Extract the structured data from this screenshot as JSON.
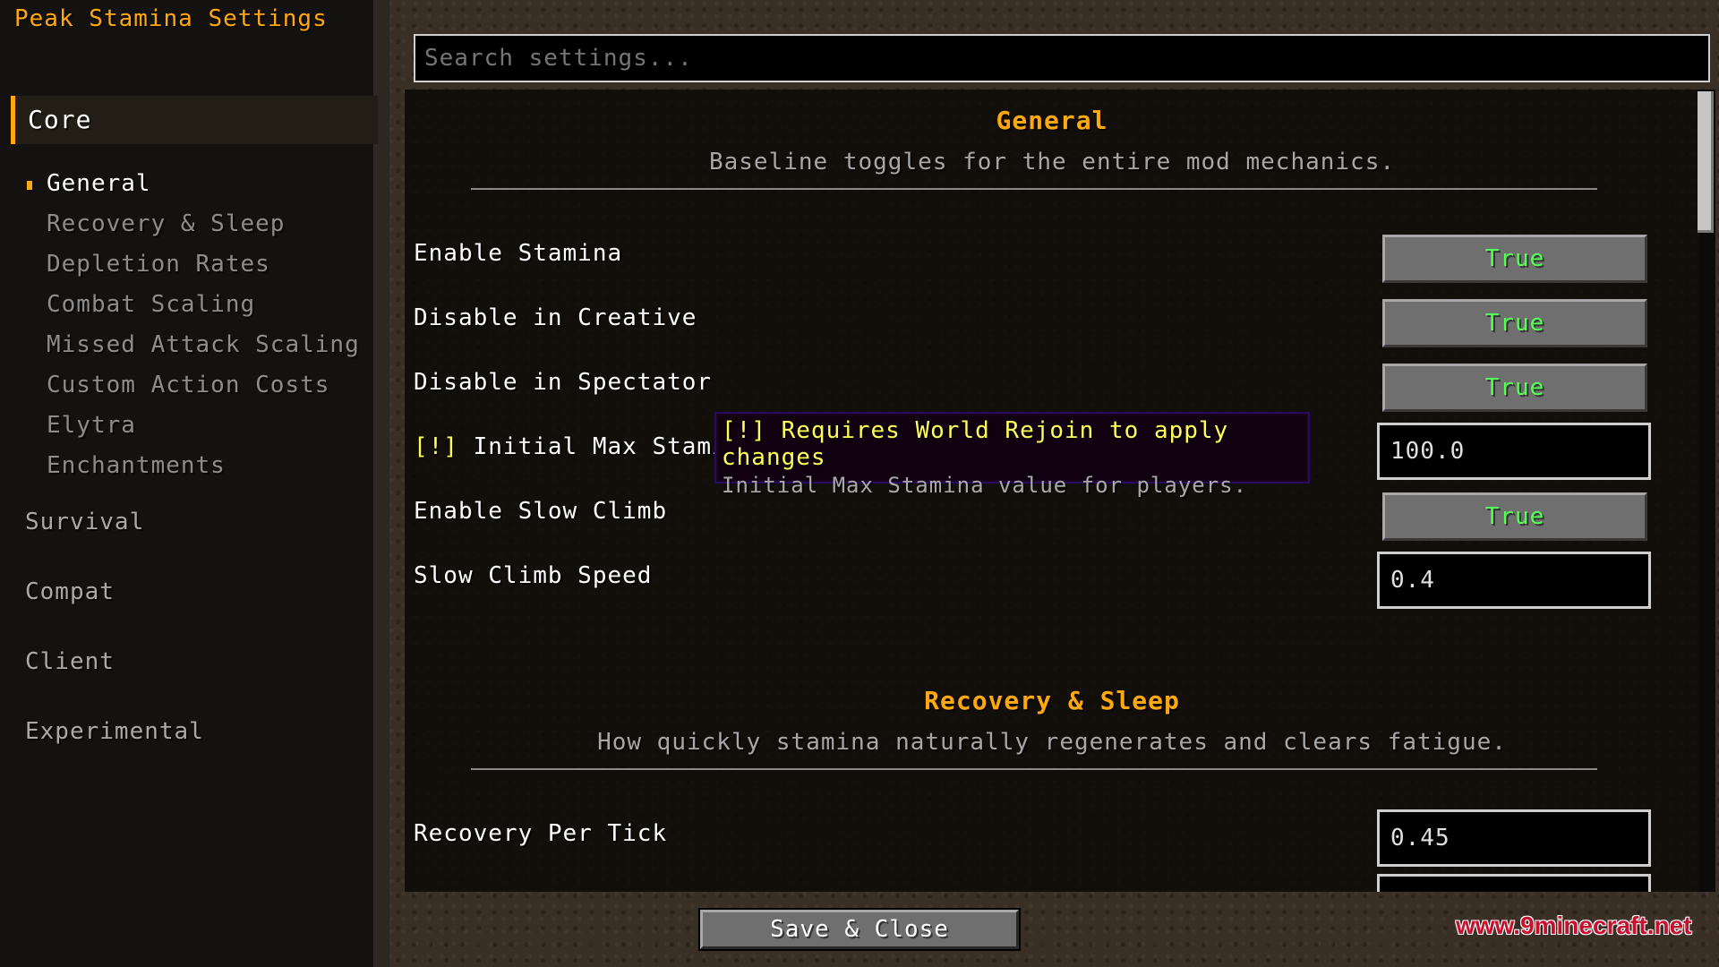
{
  "app": {
    "title": "Peak Stamina Settings"
  },
  "sidebar": {
    "active_category": "Core",
    "sub_items": [
      {
        "label": "General",
        "active": true
      },
      {
        "label": "Recovery & Sleep"
      },
      {
        "label": "Depletion Rates"
      },
      {
        "label": "Combat Scaling"
      },
      {
        "label": "Missed Attack Scaling"
      },
      {
        "label": "Custom Action Costs"
      },
      {
        "label": "Elytra"
      },
      {
        "label": "Enchantments"
      }
    ],
    "categories": [
      {
        "label": "Survival"
      },
      {
        "label": "Compat"
      },
      {
        "label": "Client"
      },
      {
        "label": "Experimental"
      }
    ]
  },
  "search": {
    "placeholder": "Search settings..."
  },
  "sections": {
    "general": {
      "title": "General",
      "description": "Baseline toggles for the entire mod mechanics.",
      "settings": [
        {
          "label": "Enable Stamina",
          "value": "True"
        },
        {
          "label": "Disable in Creative",
          "value": "True"
        },
        {
          "label": "Disable in Spectator",
          "value": "True"
        },
        {
          "warn": "[!]",
          "label": "Initial Max Stamina",
          "value": "100.0"
        },
        {
          "label": "Enable Slow Climb",
          "value": "True"
        },
        {
          "label": "Slow Climb Speed",
          "value": "0.4"
        }
      ]
    },
    "recovery": {
      "title": "Recovery & Sleep",
      "description": "How quickly stamina naturally regenerates and clears fatigue.",
      "settings": [
        {
          "label": "Recovery Per Tick",
          "value": "0.45"
        }
      ]
    }
  },
  "tooltip": {
    "line1": "[!] Requires World Rejoin to apply changes",
    "line2": "Initial Max Stamina value for players."
  },
  "footer": {
    "save_label": "Save & Close"
  },
  "watermark": "www.9minecraft.net",
  "colors": {
    "accent": "#ffa80d",
    "true_value": "#55ff55",
    "warning": "#ffff55"
  }
}
